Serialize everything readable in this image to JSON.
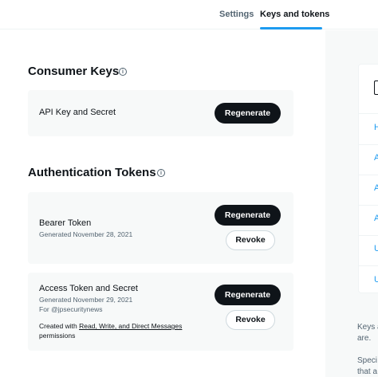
{
  "tabs": [
    {
      "label": "Settings"
    },
    {
      "label": "Keys and tokens"
    }
  ],
  "consumer_keys": {
    "title": "Consumer Keys",
    "info_icon": "info-icon",
    "card": {
      "title": "API Key and Secret",
      "button": "Regenerate"
    }
  },
  "auth_tokens": {
    "title": "Authentication Tokens",
    "info_icon": "info-icon",
    "bearer": {
      "title": "Bearer Token",
      "generated": "Generated November 28, 2021",
      "regenerate": "Regenerate",
      "revoke": "Revoke"
    },
    "access": {
      "title": "Access Token and Secret",
      "generated": "Generated November 29, 2021",
      "for": "For @jpsecuritynews",
      "note_prefix": "Created with ",
      "note_link": "Read, Write, and Direct Messages",
      "note_suffix": "permissions",
      "regenerate": "Regenerate",
      "revoke": "Revoke"
    }
  },
  "side_panel": {
    "items": [
      "H",
      "A",
      "A",
      "A",
      "U",
      "U"
    ],
    "text_lines": [
      "Keys a",
      "are.",
      "Speci",
      "that a"
    ]
  },
  "colors": {
    "accent": "#1d9bf0",
    "primary_text": "#0f1419",
    "secondary_text": "#536471",
    "card_bg": "#f7f9f9"
  }
}
